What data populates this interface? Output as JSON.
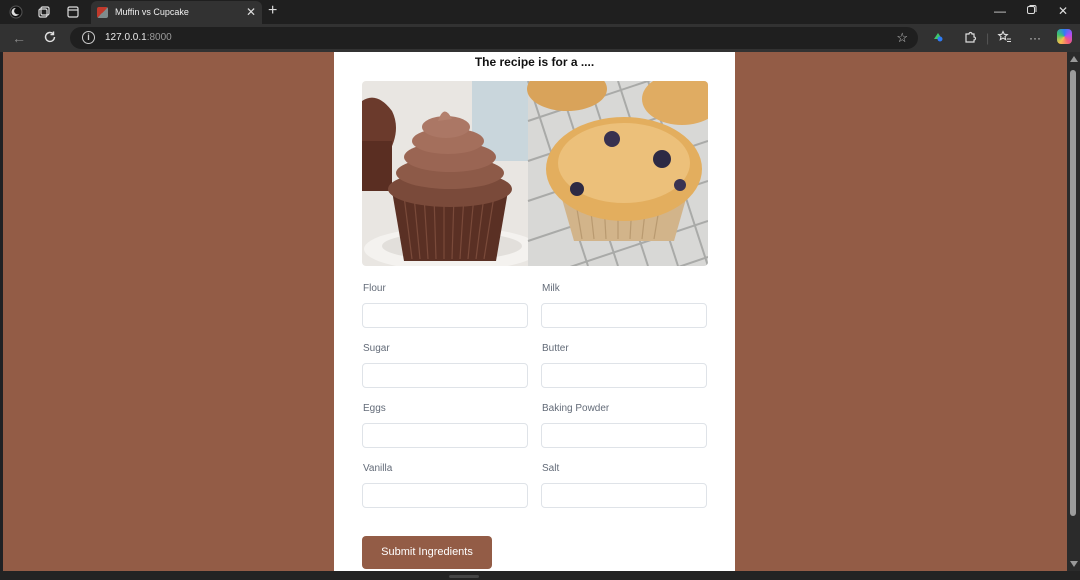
{
  "browser": {
    "tab_title": "Muffin vs Cupcake",
    "url_host": "127.0.0.1",
    "url_port": ":8000",
    "icons": {
      "profile": "profile-icon",
      "workspaces": "workspaces-icon",
      "tab_actions": "tab-actions-icon",
      "close_tab": "close-icon",
      "new_tab": "plus-icon",
      "back": "back-arrow-icon",
      "refresh": "refresh-icon",
      "site_info": "info-icon",
      "favorite": "star-icon",
      "extensions": "puzzle-icon",
      "favorites": "favorites-icon",
      "menu": "more-icon",
      "copilot": "copilot-icon"
    }
  },
  "page": {
    "heading": "The recipe is for a ....",
    "background_color": "#935c46",
    "fields": [
      {
        "label": "Flour",
        "value": ""
      },
      {
        "label": "Milk",
        "value": ""
      },
      {
        "label": "Sugar",
        "value": ""
      },
      {
        "label": "Butter",
        "value": ""
      },
      {
        "label": "Eggs",
        "value": ""
      },
      {
        "label": "Baking Powder",
        "value": ""
      },
      {
        "label": "Vanilla",
        "value": ""
      },
      {
        "label": "Salt",
        "value": ""
      }
    ],
    "submit_label": "Submit Ingredients"
  }
}
